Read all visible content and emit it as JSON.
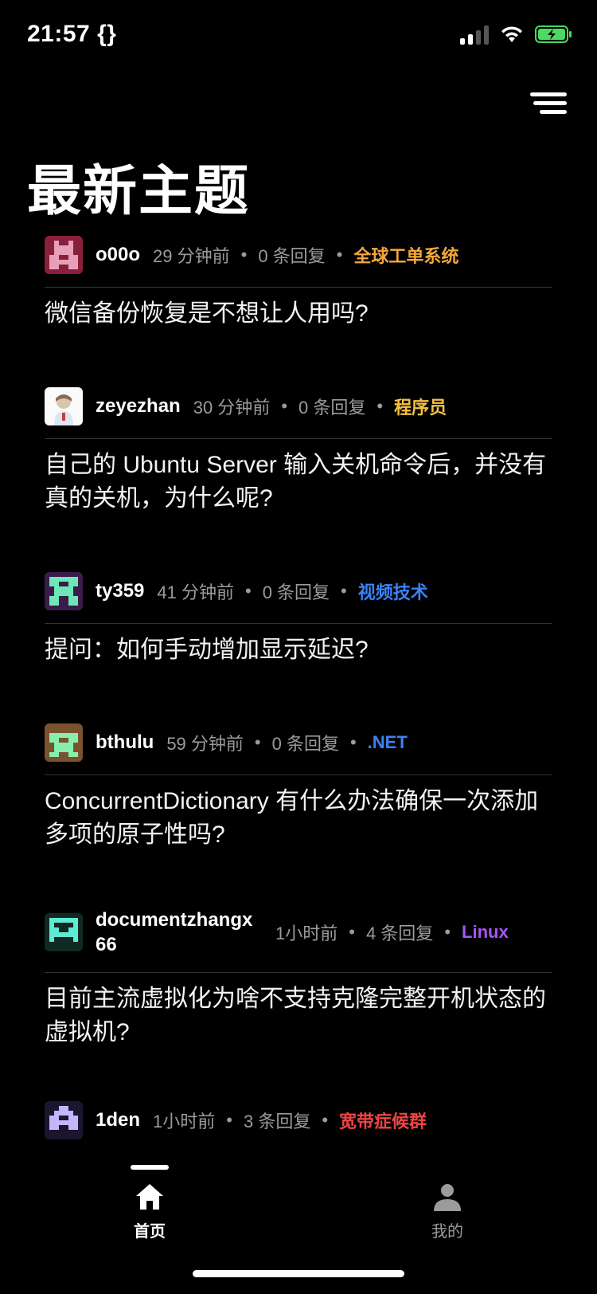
{
  "status_bar": {
    "time": "21:57 {}"
  },
  "page": {
    "title": "最新主题"
  },
  "topics": [
    {
      "author": "o00o",
      "time": "29 分钟前",
      "replies": "0 条回复",
      "node": "全球工单系统",
      "node_color": "#f4a83a",
      "title": "微信备份恢复是不想让人用吗?"
    },
    {
      "author": "zeyezhan",
      "time": "30 分钟前",
      "replies": "0 条回复",
      "node": "程序员",
      "node_color": "#f5c242",
      "title": "自己的 Ubuntu Server 输入关机命令后，并没有真的关机，为什么呢?"
    },
    {
      "author": "ty359",
      "time": "41 分钟前",
      "replies": "0 条回复",
      "node": "视频技术",
      "node_color": "#3b82f6",
      "title": "提问：如何手动增加显示延迟?"
    },
    {
      "author": "bthulu",
      "time": "59 分钟前",
      "replies": "0 条回复",
      "node": ".NET",
      "node_color": "#3b82f6",
      "title": "ConcurrentDictionary 有什么办法确保一次添加多项的原子性吗?"
    },
    {
      "author": "documentzhangx 66",
      "time": "1小时前",
      "replies": "4 条回复",
      "node": "Linux",
      "node_color": "#a855f7",
      "title": "目前主流虚拟化为啥不支持克隆完整开机状态的虚拟机?"
    },
    {
      "author": "1den",
      "time": "1小时前",
      "replies": "3 条回复",
      "node": "宽带症候群",
      "node_color": "#ef4444",
      "title": ""
    }
  ],
  "tabbar": {
    "home_label": "首页",
    "profile_label": "我的",
    "active_color": "#ffffff",
    "inactive_color": "#9b9b9b"
  }
}
